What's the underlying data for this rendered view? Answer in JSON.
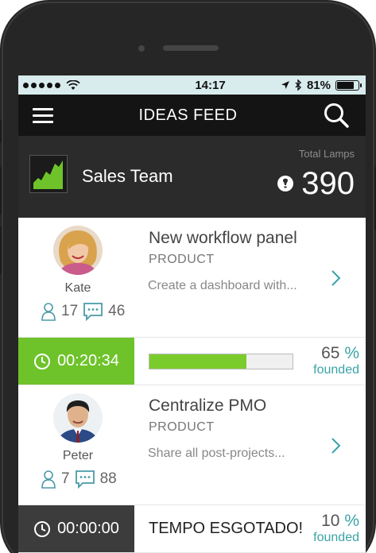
{
  "status_bar": {
    "time": "14:17",
    "battery": "81%",
    "battery_level": 0.81
  },
  "header": {
    "title": "IDEAS FEED"
  },
  "team": {
    "name": "Sales Team",
    "lamps_label": "Total Lamps",
    "lamps_value": "390"
  },
  "ideas": [
    {
      "author": "Kate",
      "followers": "17",
      "comments": "46",
      "title": "New workflow panel",
      "category": "PRODUCT",
      "description": "Create a dashboard with...",
      "timer": "00:20:34",
      "state": "active",
      "progress": 0.68,
      "percent": "65",
      "percent_sign": "%",
      "founded_label": "founded"
    },
    {
      "author": "Peter",
      "followers": "7",
      "comments": "88",
      "title": "Centralize PMO",
      "category": "PRODUCT",
      "description": "Share all post-projects...",
      "timer": "00:00:00",
      "state": "expired",
      "expired_text": "TEMPO ESGOTADO!",
      "percent": "10",
      "percent_sign": "%",
      "founded_label": "founded"
    }
  ],
  "colors": {
    "accent_green": "#6ec32a",
    "teal": "#3aa3a8",
    "dark": "#141414",
    "status_bar": "#d8ebed"
  }
}
